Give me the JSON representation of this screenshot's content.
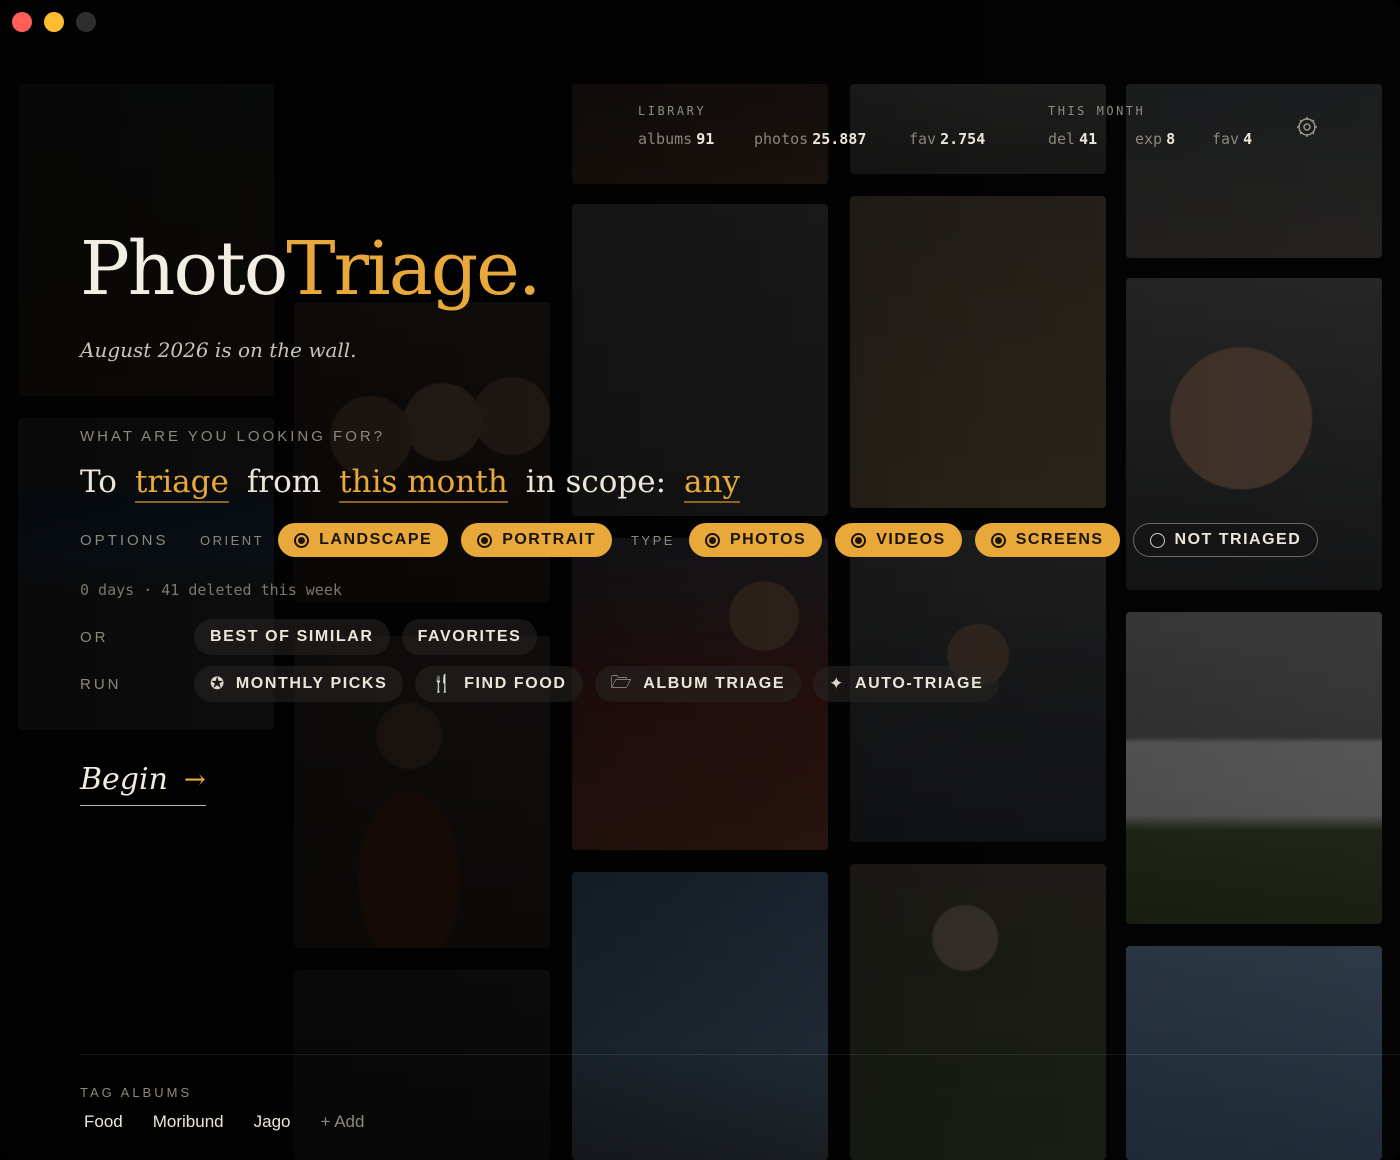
{
  "window": {
    "controls": [
      "close",
      "minimize",
      "maximize"
    ]
  },
  "stats": {
    "library_label": "LIBRARY",
    "library": [
      {
        "key": "albums",
        "value": "91"
      },
      {
        "key": "photos",
        "value": "25.887"
      },
      {
        "key": "fav",
        "value": "2.754"
      }
    ],
    "month_label": "THIS MONTH",
    "month": [
      {
        "key": "del",
        "value": "41"
      },
      {
        "key": "exp",
        "value": "8"
      },
      {
        "key": "fav",
        "value": "4"
      }
    ],
    "settings_icon": "gear-icon"
  },
  "hero": {
    "title_part1": "Photo",
    "title_part2": "Triage.",
    "subtitle": "August 2026 is on the wall."
  },
  "query": {
    "label": "WHAT ARE YOU LOOKING FOR?",
    "w1": "To",
    "action": "triage",
    "w2": "from",
    "period": "this month",
    "w3": "in scope:",
    "scope": "any"
  },
  "options": {
    "label": "OPTIONS",
    "orient_label": "ORIENT",
    "orient": [
      {
        "label": "LANDSCAPE",
        "selected": true
      },
      {
        "label": "PORTRAIT",
        "selected": true
      }
    ],
    "type_label": "TYPE",
    "type": [
      {
        "label": "PHOTOS",
        "selected": true
      },
      {
        "label": "VIDEOS",
        "selected": true
      },
      {
        "label": "SCREENS",
        "selected": true
      },
      {
        "label": "NOT TRIAGED",
        "selected": false
      }
    ],
    "status": "0 days · 41 deleted this week"
  },
  "or_row": {
    "label": "OR",
    "items": [
      "BEST OF SIMILAR",
      "FAVORITES"
    ]
  },
  "run_row": {
    "label": "RUN",
    "items": [
      {
        "label": "MONTHLY PICKS",
        "icon": "star-circle-icon"
      },
      {
        "label": "FIND FOOD",
        "icon": "fork-knife-icon"
      },
      {
        "label": "ALBUM TRIAGE",
        "icon": "album-icon"
      },
      {
        "label": "AUTO-TRIAGE",
        "icon": "sparkle-icon"
      }
    ]
  },
  "begin": {
    "label": "Begin",
    "icon": "arrow-right-icon"
  },
  "tag_albums": {
    "label": "TAG ALBUMS",
    "items": [
      "Food",
      "Moribund",
      "Jago"
    ],
    "add_label": "+ Add"
  },
  "colors": {
    "accent": "#e8a93a",
    "background": "#050505",
    "text": "#ece6da",
    "muted": "#8d887e"
  }
}
